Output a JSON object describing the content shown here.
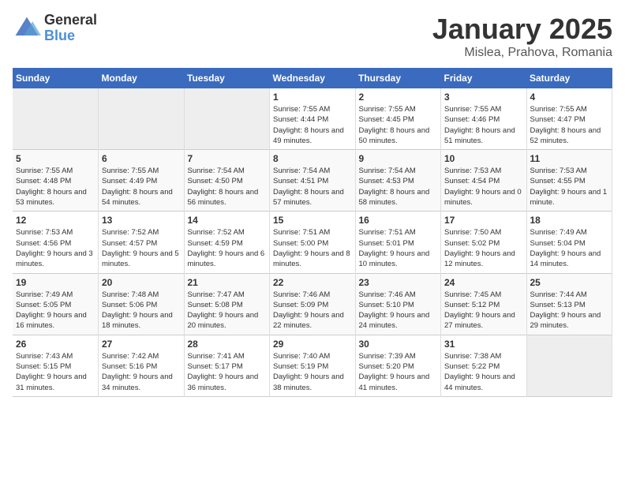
{
  "logo": {
    "line1": "General",
    "line2": "Blue"
  },
  "title": "January 2025",
  "subtitle": "Mislea, Prahova, Romania",
  "days_of_week": [
    "Sunday",
    "Monday",
    "Tuesday",
    "Wednesday",
    "Thursday",
    "Friday",
    "Saturday"
  ],
  "weeks": [
    [
      {
        "day": "",
        "sunrise": "",
        "sunset": "",
        "daylight": ""
      },
      {
        "day": "",
        "sunrise": "",
        "sunset": "",
        "daylight": ""
      },
      {
        "day": "",
        "sunrise": "",
        "sunset": "",
        "daylight": ""
      },
      {
        "day": "1",
        "sunrise": "Sunrise: 7:55 AM",
        "sunset": "Sunset: 4:44 PM",
        "daylight": "Daylight: 8 hours and 49 minutes."
      },
      {
        "day": "2",
        "sunrise": "Sunrise: 7:55 AM",
        "sunset": "Sunset: 4:45 PM",
        "daylight": "Daylight: 8 hours and 50 minutes."
      },
      {
        "day": "3",
        "sunrise": "Sunrise: 7:55 AM",
        "sunset": "Sunset: 4:46 PM",
        "daylight": "Daylight: 8 hours and 51 minutes."
      },
      {
        "day": "4",
        "sunrise": "Sunrise: 7:55 AM",
        "sunset": "Sunset: 4:47 PM",
        "daylight": "Daylight: 8 hours and 52 minutes."
      }
    ],
    [
      {
        "day": "5",
        "sunrise": "Sunrise: 7:55 AM",
        "sunset": "Sunset: 4:48 PM",
        "daylight": "Daylight: 8 hours and 53 minutes."
      },
      {
        "day": "6",
        "sunrise": "Sunrise: 7:55 AM",
        "sunset": "Sunset: 4:49 PM",
        "daylight": "Daylight: 8 hours and 54 minutes."
      },
      {
        "day": "7",
        "sunrise": "Sunrise: 7:54 AM",
        "sunset": "Sunset: 4:50 PM",
        "daylight": "Daylight: 8 hours and 56 minutes."
      },
      {
        "day": "8",
        "sunrise": "Sunrise: 7:54 AM",
        "sunset": "Sunset: 4:51 PM",
        "daylight": "Daylight: 8 hours and 57 minutes."
      },
      {
        "day": "9",
        "sunrise": "Sunrise: 7:54 AM",
        "sunset": "Sunset: 4:53 PM",
        "daylight": "Daylight: 8 hours and 58 minutes."
      },
      {
        "day": "10",
        "sunrise": "Sunrise: 7:53 AM",
        "sunset": "Sunset: 4:54 PM",
        "daylight": "Daylight: 9 hours and 0 minutes."
      },
      {
        "day": "11",
        "sunrise": "Sunrise: 7:53 AM",
        "sunset": "Sunset: 4:55 PM",
        "daylight": "Daylight: 9 hours and 1 minute."
      }
    ],
    [
      {
        "day": "12",
        "sunrise": "Sunrise: 7:53 AM",
        "sunset": "Sunset: 4:56 PM",
        "daylight": "Daylight: 9 hours and 3 minutes."
      },
      {
        "day": "13",
        "sunrise": "Sunrise: 7:52 AM",
        "sunset": "Sunset: 4:57 PM",
        "daylight": "Daylight: 9 hours and 5 minutes."
      },
      {
        "day": "14",
        "sunrise": "Sunrise: 7:52 AM",
        "sunset": "Sunset: 4:59 PM",
        "daylight": "Daylight: 9 hours and 6 minutes."
      },
      {
        "day": "15",
        "sunrise": "Sunrise: 7:51 AM",
        "sunset": "Sunset: 5:00 PM",
        "daylight": "Daylight: 9 hours and 8 minutes."
      },
      {
        "day": "16",
        "sunrise": "Sunrise: 7:51 AM",
        "sunset": "Sunset: 5:01 PM",
        "daylight": "Daylight: 9 hours and 10 minutes."
      },
      {
        "day": "17",
        "sunrise": "Sunrise: 7:50 AM",
        "sunset": "Sunset: 5:02 PM",
        "daylight": "Daylight: 9 hours and 12 minutes."
      },
      {
        "day": "18",
        "sunrise": "Sunrise: 7:49 AM",
        "sunset": "Sunset: 5:04 PM",
        "daylight": "Daylight: 9 hours and 14 minutes."
      }
    ],
    [
      {
        "day": "19",
        "sunrise": "Sunrise: 7:49 AM",
        "sunset": "Sunset: 5:05 PM",
        "daylight": "Daylight: 9 hours and 16 minutes."
      },
      {
        "day": "20",
        "sunrise": "Sunrise: 7:48 AM",
        "sunset": "Sunset: 5:06 PM",
        "daylight": "Daylight: 9 hours and 18 minutes."
      },
      {
        "day": "21",
        "sunrise": "Sunrise: 7:47 AM",
        "sunset": "Sunset: 5:08 PM",
        "daylight": "Daylight: 9 hours and 20 minutes."
      },
      {
        "day": "22",
        "sunrise": "Sunrise: 7:46 AM",
        "sunset": "Sunset: 5:09 PM",
        "daylight": "Daylight: 9 hours and 22 minutes."
      },
      {
        "day": "23",
        "sunrise": "Sunrise: 7:46 AM",
        "sunset": "Sunset: 5:10 PM",
        "daylight": "Daylight: 9 hours and 24 minutes."
      },
      {
        "day": "24",
        "sunrise": "Sunrise: 7:45 AM",
        "sunset": "Sunset: 5:12 PM",
        "daylight": "Daylight: 9 hours and 27 minutes."
      },
      {
        "day": "25",
        "sunrise": "Sunrise: 7:44 AM",
        "sunset": "Sunset: 5:13 PM",
        "daylight": "Daylight: 9 hours and 29 minutes."
      }
    ],
    [
      {
        "day": "26",
        "sunrise": "Sunrise: 7:43 AM",
        "sunset": "Sunset: 5:15 PM",
        "daylight": "Daylight: 9 hours and 31 minutes."
      },
      {
        "day": "27",
        "sunrise": "Sunrise: 7:42 AM",
        "sunset": "Sunset: 5:16 PM",
        "daylight": "Daylight: 9 hours and 34 minutes."
      },
      {
        "day": "28",
        "sunrise": "Sunrise: 7:41 AM",
        "sunset": "Sunset: 5:17 PM",
        "daylight": "Daylight: 9 hours and 36 minutes."
      },
      {
        "day": "29",
        "sunrise": "Sunrise: 7:40 AM",
        "sunset": "Sunset: 5:19 PM",
        "daylight": "Daylight: 9 hours and 38 minutes."
      },
      {
        "day": "30",
        "sunrise": "Sunrise: 7:39 AM",
        "sunset": "Sunset: 5:20 PM",
        "daylight": "Daylight: 9 hours and 41 minutes."
      },
      {
        "day": "31",
        "sunrise": "Sunrise: 7:38 AM",
        "sunset": "Sunset: 5:22 PM",
        "daylight": "Daylight: 9 hours and 44 minutes."
      },
      {
        "day": "",
        "sunrise": "",
        "sunset": "",
        "daylight": ""
      }
    ]
  ]
}
